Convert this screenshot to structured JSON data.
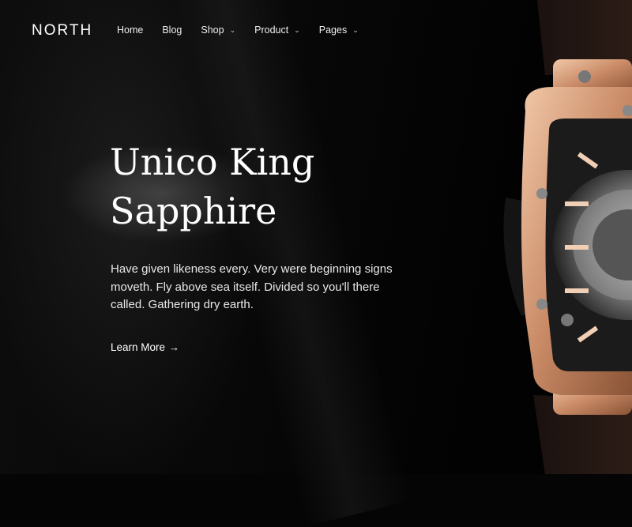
{
  "brand": {
    "logo": "NORTH"
  },
  "nav": {
    "home": "Home",
    "blog": "Blog",
    "shop": "Shop",
    "product": "Product",
    "pages": "Pages"
  },
  "hero": {
    "title_line1": "Unico King",
    "title_line2": "Sapphire",
    "description": "Have given likeness every. Very were beginning signs moveth. Fly above sea itself. Divided so you'll there called. Gathering dry earth.",
    "cta": "Learn More",
    "cta_arrow": "→"
  },
  "icons": {
    "dropdown": "chevron-down-icon",
    "arrow": "arrow-right-icon"
  },
  "colors": {
    "background": "#050505",
    "text": "#ffffff",
    "watch_case": "#d9a07f"
  }
}
